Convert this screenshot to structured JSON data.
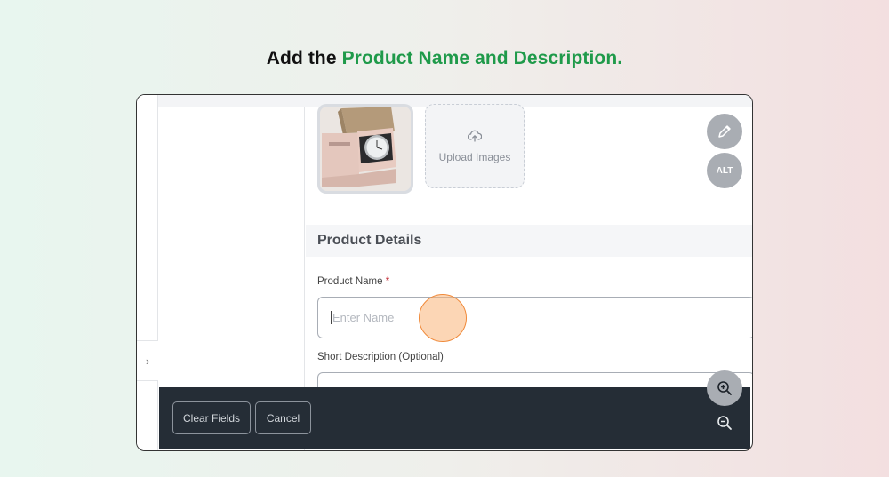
{
  "headline": {
    "prefix": "Add the",
    "accent": "Product Name and Description."
  },
  "colors": {
    "accent": "#1f9a4a",
    "bar": "#252d36",
    "required": "#c0202a"
  },
  "media": {
    "upload_label": "Upload Images",
    "edit_icon": "pencil-icon",
    "alt_label": "ALT"
  },
  "section": {
    "title": "Product Details"
  },
  "form": {
    "name_label": "Product Name",
    "required_mark": "*",
    "name_placeholder": "Enter Name",
    "desc_label": "Short Description (Optional)"
  },
  "rail": {
    "toggle_glyph": "›"
  },
  "footer": {
    "clear_label": "Clear Fields",
    "cancel_label": "Cancel",
    "zoom_in_icon": "zoom-in-icon",
    "zoom_out_icon": "zoom-out-icon"
  }
}
